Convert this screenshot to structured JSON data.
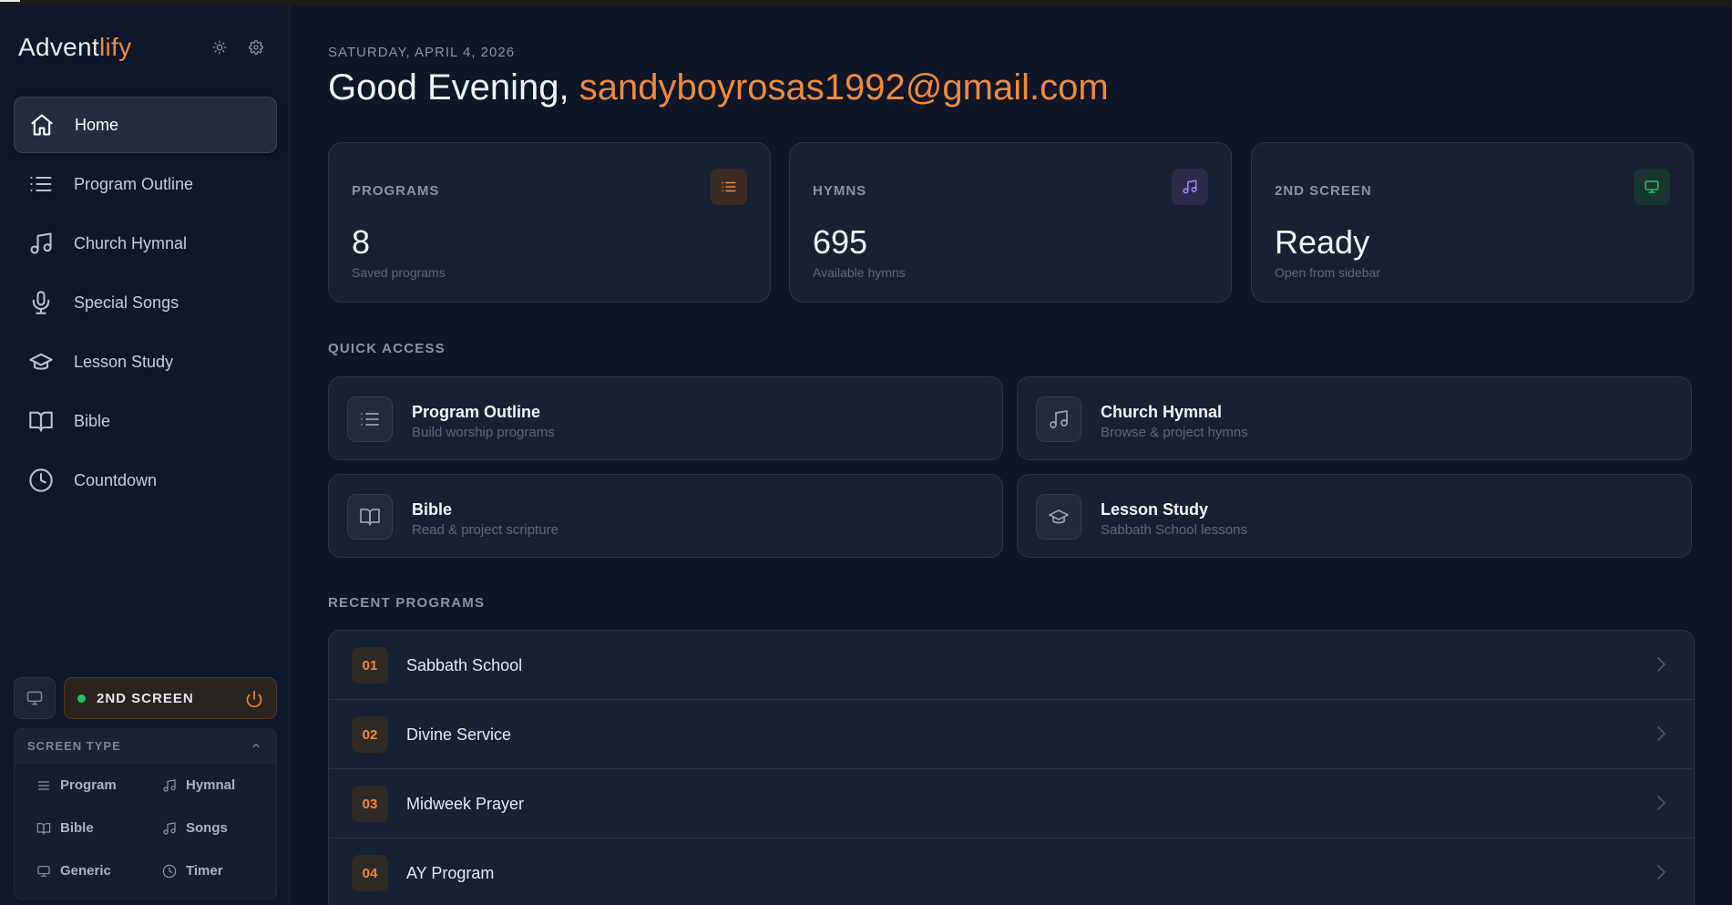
{
  "app": {
    "brand_main": "Advent",
    "brand_accent": "lify",
    "sun_icon": "sun-icon",
    "gear_icon": "gear-icon"
  },
  "sidebar": {
    "items": [
      {
        "label": "Home",
        "icon": "home-icon",
        "active": true
      },
      {
        "label": "Program Outline",
        "icon": "list-icon"
      },
      {
        "label": "Church Hymnal",
        "icon": "music-note-icon"
      },
      {
        "label": "Special Songs",
        "icon": "microphone-icon"
      },
      {
        "label": "Lesson Study",
        "icon": "graduation-cap-icon"
      },
      {
        "label": "Bible",
        "icon": "book-icon"
      },
      {
        "label": "Countdown",
        "icon": "clock-icon"
      }
    ],
    "second_screen": {
      "label": "2ND SCREEN",
      "status_color": "#22c55e",
      "power_color": "#f08a3a"
    },
    "screen_type": {
      "title": "SCREEN TYPE",
      "options": [
        {
          "label": "Program",
          "icon": "list-icon"
        },
        {
          "label": "Hymnal",
          "icon": "music-note-icon"
        },
        {
          "label": "Bible",
          "icon": "book-icon"
        },
        {
          "label": "Songs",
          "icon": "music-note-icon"
        },
        {
          "label": "Generic",
          "icon": "monitor-icon"
        },
        {
          "label": "Timer",
          "icon": "clock-icon"
        }
      ]
    }
  },
  "main": {
    "date": "SATURDAY, APRIL 4, 2026",
    "greeting_prefix": "Good Evening, ",
    "user_email": "sandyboyrosas1992@gmail.com",
    "stats": [
      {
        "label": "PROGRAMS",
        "value": "8",
        "sub": "Saved programs",
        "icon": "list-icon",
        "color": "#f08a3a"
      },
      {
        "label": "HYMNS",
        "value": "695",
        "sub": "Available hymns",
        "icon": "music-note-icon",
        "color": "#a78bfa"
      },
      {
        "label": "2ND SCREEN",
        "value": "Ready",
        "sub": "Open from sidebar",
        "icon": "monitor-icon",
        "color": "#22c55e"
      }
    ],
    "quick_access_title": "QUICK ACCESS",
    "quick_access": [
      {
        "title": "Program Outline",
        "sub": "Build worship programs",
        "icon": "list-icon"
      },
      {
        "title": "Church Hymnal",
        "sub": "Browse & project hymns",
        "icon": "music-note-icon"
      },
      {
        "title": "Bible",
        "sub": "Read & project scripture",
        "icon": "book-icon"
      },
      {
        "title": "Lesson Study",
        "sub": "Sabbath School lessons",
        "icon": "graduation-cap-icon"
      }
    ],
    "recent_title": "RECENT PROGRAMS",
    "recent": [
      {
        "num": "01",
        "name": "Sabbath School"
      },
      {
        "num": "02",
        "name": "Divine Service"
      },
      {
        "num": "03",
        "name": "Midweek Prayer"
      },
      {
        "num": "04",
        "name": "AY Program"
      }
    ]
  },
  "colors": {
    "accent": "#f08a3a",
    "background": "#0e1628",
    "card": "#182133"
  }
}
